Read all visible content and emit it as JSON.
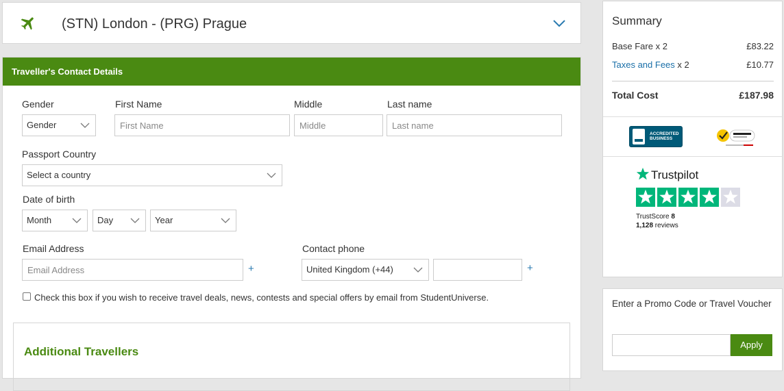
{
  "flight": {
    "route": "(STN) London - (PRG) Prague",
    "icon": "plane-icon",
    "expand_icon": "chevron-down-icon"
  },
  "contact": {
    "header": "Traveller's Contact Details",
    "gender": {
      "label": "Gender",
      "value": "Gender"
    },
    "first_name": {
      "label": "First Name",
      "placeholder": "First Name"
    },
    "middle": {
      "label": "Middle",
      "placeholder": "Middle"
    },
    "last_name": {
      "label": "Last name",
      "placeholder": "Last name"
    },
    "passport": {
      "label": "Passport Country",
      "value": "Select a country"
    },
    "dob": {
      "label": "Date of birth",
      "month": "Month",
      "day": "Day",
      "year": "Year"
    },
    "email": {
      "label": "Email Address",
      "placeholder": "Email Address",
      "add": "+"
    },
    "phone": {
      "label": "Contact phone",
      "country": "United Kingdom (+44)",
      "add": "+"
    },
    "optin": "Check this box if you wish to receive travel deals, news, contests and special offers by email from StudentUniverse."
  },
  "additional": {
    "title": "Additional Travellers"
  },
  "summary": {
    "title": "Summary",
    "base_fare": {
      "label": "Base Fare x 2",
      "value": "£83.22"
    },
    "taxes": {
      "link": "Taxes and Fees",
      "suffix": " x 2",
      "value": "£10.77"
    },
    "total": {
      "label": "Total Cost",
      "value": "£187.98"
    },
    "bbb_text": "ACCREDITED BUSINESS",
    "trustpilot": {
      "name": "Trustpilot",
      "score_label": "TrustScore ",
      "score": "8",
      "reviews_count": "1,128",
      "reviews_label": " reviews",
      "rating": 4,
      "max": 5
    },
    "colors": {
      "green": "#00b67a",
      "grey": "#dcdce6"
    }
  },
  "promo": {
    "title": "Enter a Promo Code or Travel Voucher",
    "button": "Apply"
  },
  "colors": {
    "accent": "#4a8a12",
    "link": "#1a6fa8"
  }
}
